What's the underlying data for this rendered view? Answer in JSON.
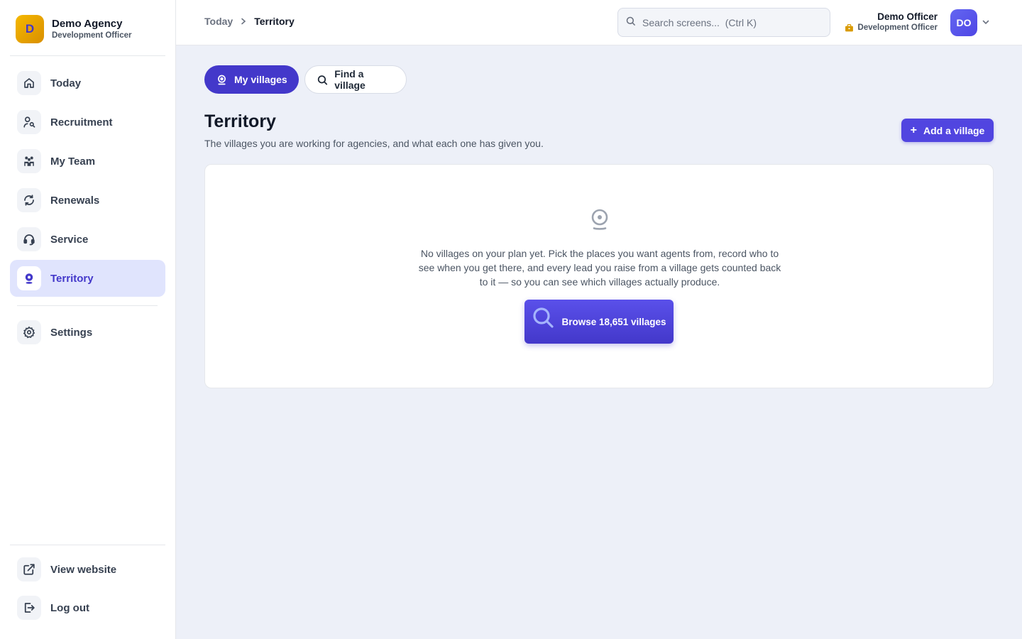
{
  "brand": {
    "logo_letter": "D",
    "name": "Demo Agency",
    "role": "Development Officer"
  },
  "sidebar": {
    "items": [
      {
        "label": "Today",
        "icon": "home-icon"
      },
      {
        "label": "Recruitment",
        "icon": "user-search-icon"
      },
      {
        "label": "My Team",
        "icon": "team-icon"
      },
      {
        "label": "Renewals",
        "icon": "refresh-icon"
      },
      {
        "label": "Service",
        "icon": "headset-icon"
      },
      {
        "label": "Territory",
        "icon": "map-pin-icon",
        "active": true
      },
      {
        "label": "Settings",
        "icon": "gear-icon"
      }
    ],
    "footer": [
      {
        "label": "View website",
        "icon": "external-link-icon"
      },
      {
        "label": "Log out",
        "icon": "logout-icon"
      }
    ]
  },
  "topbar": {
    "breadcrumb": [
      "Today",
      "Territory"
    ],
    "search_placeholder": "Search screens...  (Ctrl K)",
    "user": {
      "name": "Demo Officer",
      "role": "Development Officer",
      "initials": "DO"
    }
  },
  "tabs": [
    {
      "label": "My villages",
      "active": true
    },
    {
      "label": "Find a village",
      "active": false
    }
  ],
  "page": {
    "title": "Territory",
    "subtitle": "The villages you are working for agencies, and what each one has given you.",
    "add_button": "Add a village"
  },
  "empty_state": {
    "message": "No villages on your plan yet. Pick the places you want agents from, record who to see when you get there, and every lead you raise from a village gets counted back to it — so you can see which villages actually produce.",
    "button": "Browse 18,651 villages"
  },
  "colors": {
    "accent": "#4338ca",
    "brand": "#f5b800",
    "active_bg": "#e0e4fd"
  }
}
